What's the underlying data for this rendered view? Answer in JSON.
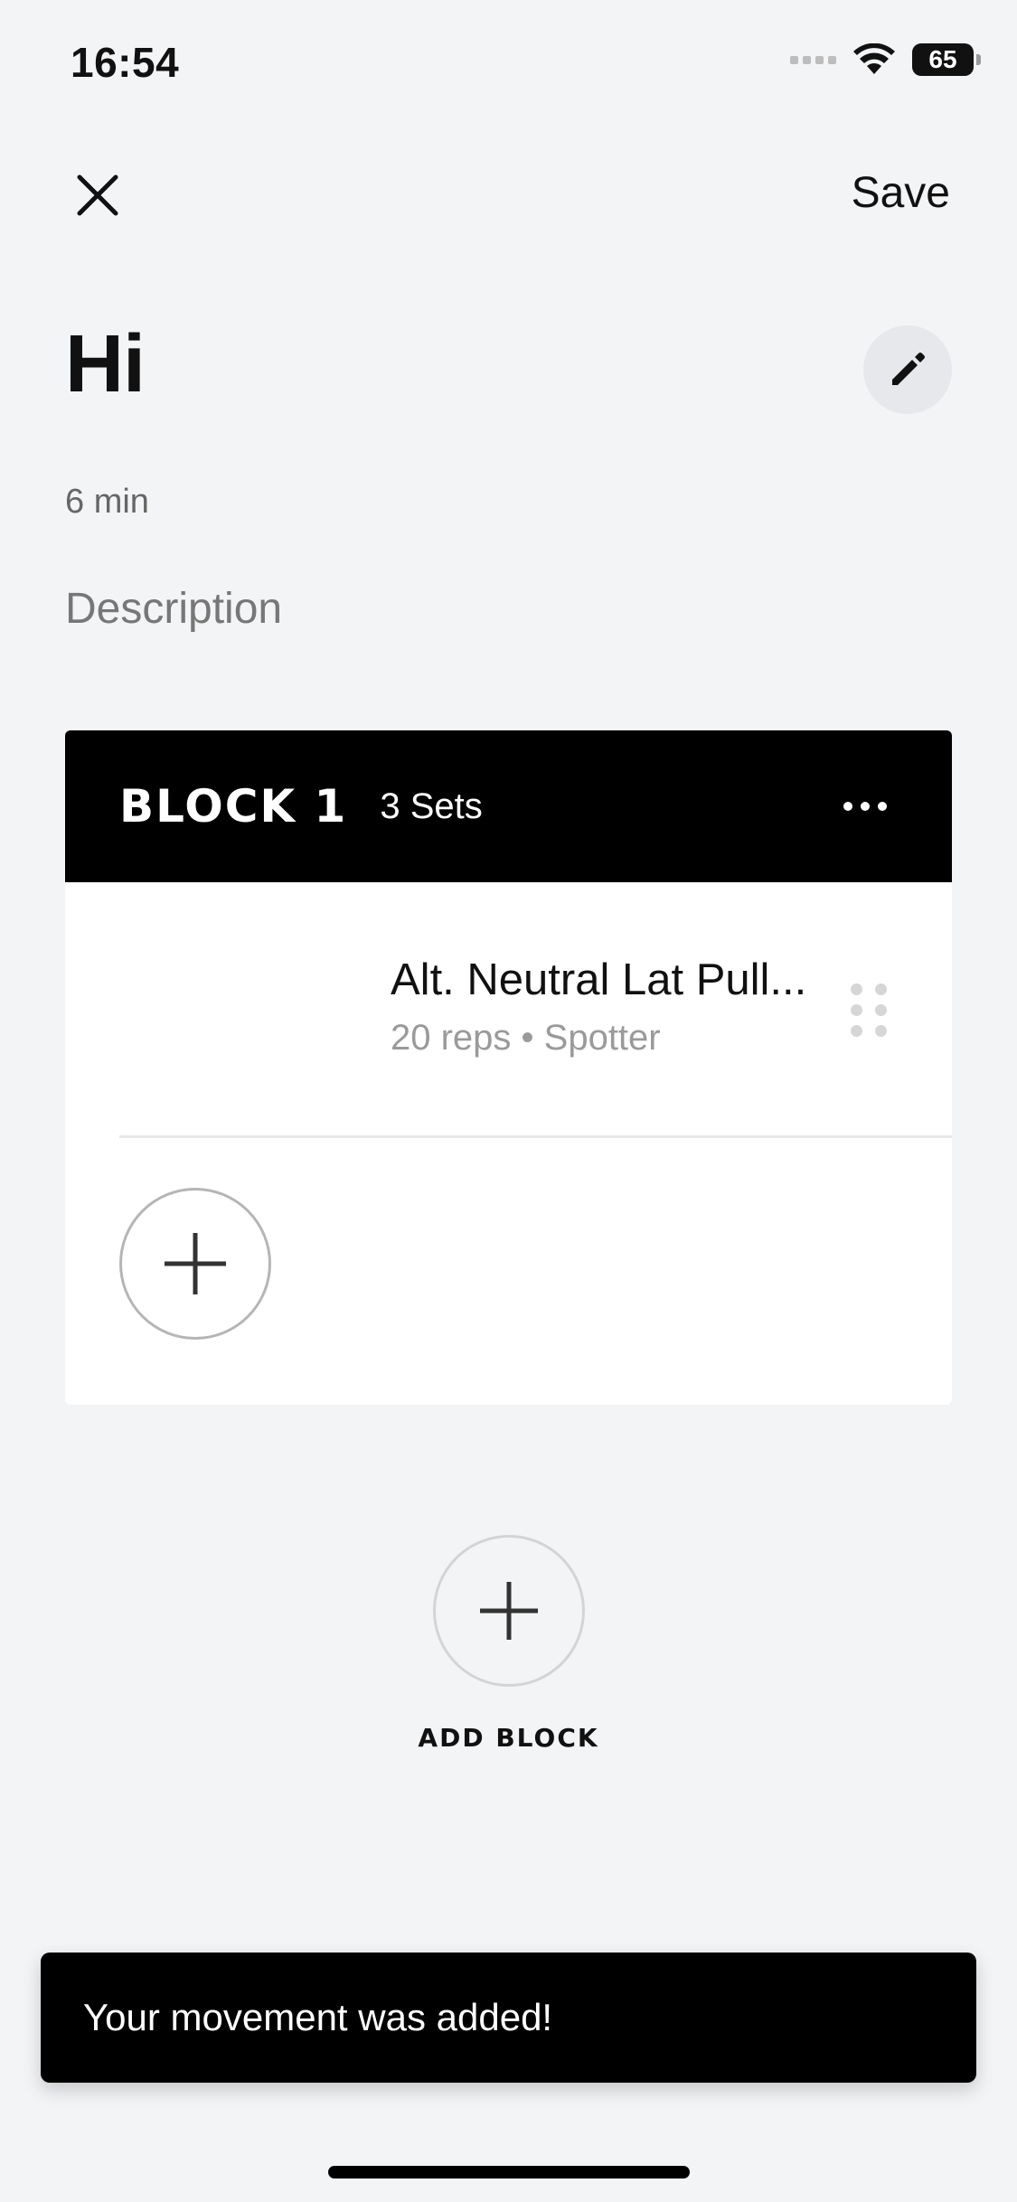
{
  "status_bar": {
    "time": "16:54",
    "battery": "65"
  },
  "nav": {
    "close_icon": "close-icon",
    "save_label": "Save"
  },
  "workout": {
    "title": "Hi",
    "duration": "6 min",
    "description_placeholder": "Description"
  },
  "block": {
    "title": "BLOCK 1",
    "sets": "3 Sets",
    "movements": [
      {
        "name": "Alt. Neutral Lat Pull...",
        "meta": "20 reps • Spotter"
      }
    ]
  },
  "add_block": {
    "label": "ADD BLOCK"
  },
  "toast": {
    "message": "Your movement was added!"
  },
  "colors": {
    "background": "#f3f4f6",
    "header_black": "#000000",
    "text_primary": "#111111",
    "text_muted": "#9a9a9a"
  }
}
